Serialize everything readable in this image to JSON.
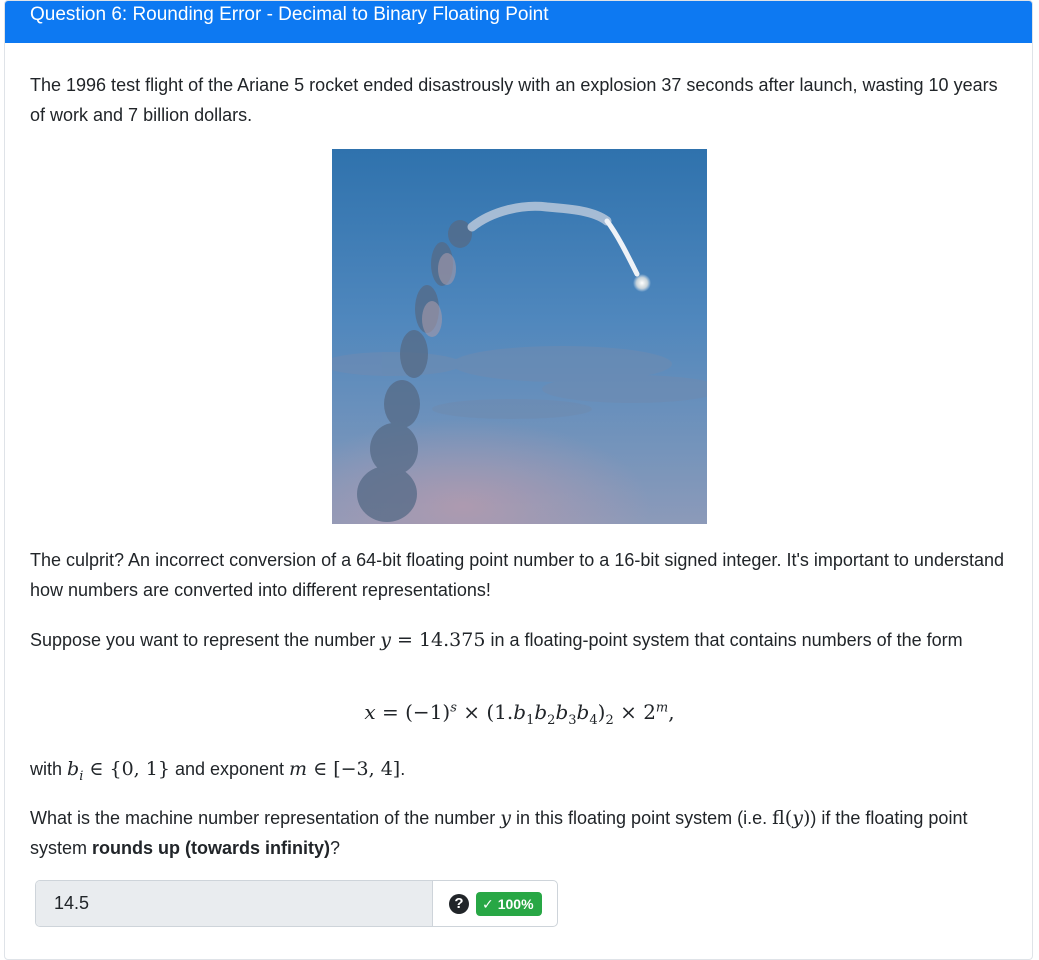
{
  "header": {
    "title": "Question 6: Rounding Error - Decimal to Binary Floating Point"
  },
  "intro": {
    "text": "The 1996 test flight of the Ariane 5 rocket ended disastrously with an explosion 37 seconds after launch, wasting 10 years of work and 7 billion dollars."
  },
  "culprit": {
    "text": "The culprit? An incorrect conversion of a 64-bit floating point number to a 16-bit signed integer. It's important to understand how numbers are converted into different representations!"
  },
  "suppose": {
    "before": "Suppose you want to represent the number ",
    "math": "y = 14.375",
    "after": " in a floating-point system that contains numbers of the form"
  },
  "formula": "x = (−1)^s × (1.b1b2b3b4)2 × 2^m,",
  "constraints": {
    "before": "with ",
    "math1": "b_i ∈ {0, 1}",
    "middle": " and exponent ",
    "math2": "m ∈ [−3, 4]",
    "after": "."
  },
  "question": {
    "before": "What is the machine number representation of the number ",
    "math1": "y",
    "middle": " in this floating point system (i.e. ",
    "math2": "fl(y)",
    "after_math": ") if the floating point system ",
    "bold": "rounds up (towards infinity)",
    "end": "?"
  },
  "answer": {
    "value": "14.5",
    "help_icon": "question-circle-icon",
    "score_label": "100%",
    "score_icon": "check-icon",
    "score_color": "#28a745"
  },
  "colors": {
    "header": "#0d79f2",
    "text": "#212529"
  }
}
